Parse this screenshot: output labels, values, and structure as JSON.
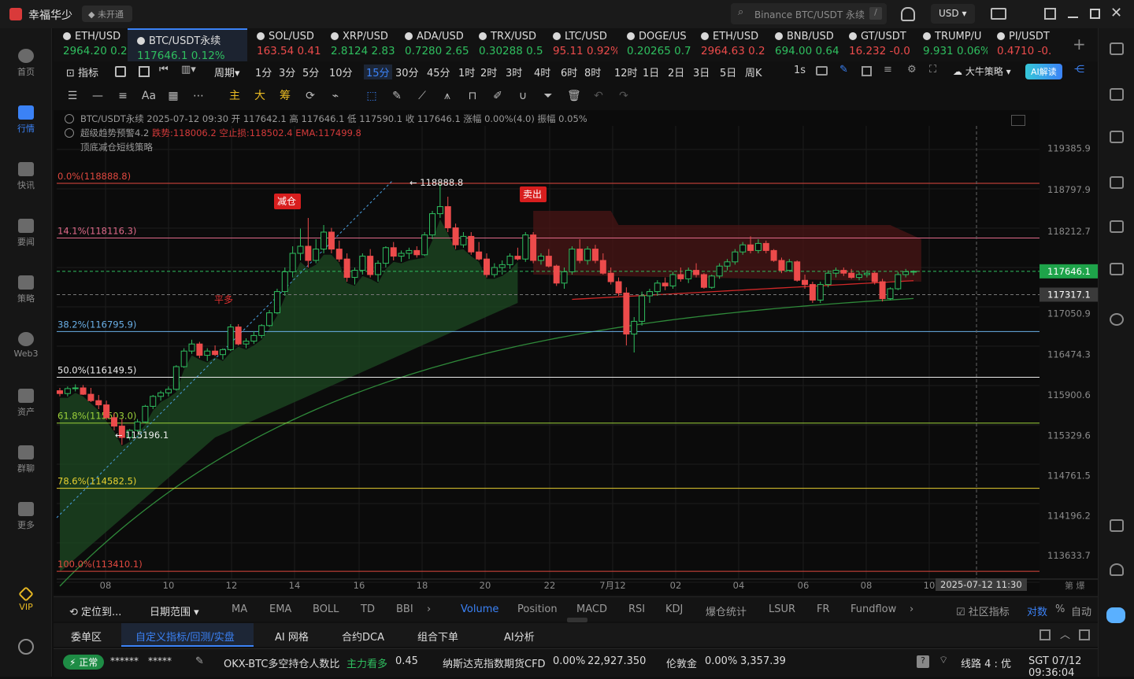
{
  "app": {
    "name": "幸福华少",
    "login_badge": "未开通",
    "search_placeholder": "Binance BTC/USDT 永续",
    "search_shortcut": "/",
    "currency": "USD"
  },
  "tickers": [
    {
      "symbol": "ETH/USD",
      "price": "2964.20",
      "change": "0.2",
      "dir": "up"
    },
    {
      "symbol": "BTC/USDT永续",
      "price": "117646.1",
      "change": "0.12%",
      "dir": "up",
      "active": true
    },
    {
      "symbol": "SOL/USD",
      "price": "163.54",
      "change": "0.41",
      "dir": "dn"
    },
    {
      "symbol": "XRP/USD",
      "price": "2.8124",
      "change": "2.83",
      "dir": "up"
    },
    {
      "symbol": "ADA/USD",
      "price": "0.7280",
      "change": "2.65",
      "dir": "up"
    },
    {
      "symbol": "TRX/USD",
      "price": "0.30288",
      "change": "0.5",
      "dir": "up"
    },
    {
      "symbol": "LTC/USD",
      "price": "95.11",
      "change": "0.92%",
      "dir": "dn"
    },
    {
      "symbol": "DOGE/US",
      "price": "0.20265",
      "change": "0.7",
      "dir": "up"
    },
    {
      "symbol": "ETH/USD",
      "price": "2964.63",
      "change": "0.2",
      "dir": "dn"
    },
    {
      "symbol": "BNB/USD",
      "price": "694.00",
      "change": "0.64",
      "dir": "up"
    },
    {
      "symbol": "GT/USDT",
      "price": "16.232",
      "change": "-0.0",
      "dir": "dn"
    },
    {
      "symbol": "TRUMP/U",
      "price": "9.931",
      "change": "0.06%",
      "dir": "up"
    },
    {
      "symbol": "PI/USDT",
      "price": "0.4710",
      "change": "-0.1",
      "dir": "dn"
    }
  ],
  "toolbar": {
    "indicators": "指标",
    "period": "周期",
    "strategy": "大牛策略",
    "ai_button": "AI解读",
    "seconds": "1s",
    "timeframes": [
      "1分",
      "3分",
      "5分",
      "10分",
      "15分",
      "30分",
      "45分",
      "1时",
      "2时",
      "3时",
      "4时",
      "6时",
      "8时",
      "12时",
      "1日",
      "2日",
      "3日",
      "5日",
      "周K"
    ],
    "active_tf": "15分"
  },
  "drawbar": [
    "主",
    "大",
    "筹"
  ],
  "info": {
    "line1": "BTC/USDT永续 2025-07-12 09:30 开 117642.1 高 117646.1 低 117590.1 收 117646.1 涨幅 0.00%(4.0) 振幅 0.05%",
    "line2a": "超级趋势预警4.2",
    "line2b": "跌势:118006.2 空止损:118502.4 EMA:117499.8",
    "line3": "顶底减仓短线策略"
  },
  "fib": [
    {
      "label": "0.0%(118888.8)",
      "color": "#e0483f",
      "price": 118888.8
    },
    {
      "label": "14.1%(118116.3)",
      "color": "#e06a8a",
      "price": 118116.3
    },
    {
      "label": "38.2%(116795.9)",
      "color": "#6ab0e8",
      "price": 116795.9
    },
    {
      "label": "50.0%(116149.5)",
      "color": "#eaeaea",
      "price": 116149.5
    },
    {
      "label": "61.8%(115503.0)",
      "color": "#9bd13a",
      "price": 115503.0
    },
    {
      "label": "78.6%(114582.5)",
      "color": "#e8d030",
      "price": 114582.5
    },
    {
      "label": "100.0%(113410.1)",
      "color": "#e0483f",
      "price": 113410.1
    }
  ],
  "yticks": [
    "119385.9",
    "118797.9",
    "118212.7",
    "117646.1",
    "117317.1",
    "117050.9",
    "116474.3",
    "115900.6",
    "115329.6",
    "114761.5",
    "114196.2",
    "113633.7"
  ],
  "xticks": [
    "08",
    "10",
    "12",
    "14",
    "16",
    "18",
    "20",
    "22",
    "7月12",
    "02",
    "04",
    "06",
    "08",
    "10"
  ],
  "crosshair_time": "2025-07-12 11:30",
  "signals": {
    "reduce": "减仓",
    "sell": "卖出",
    "flat": "平多",
    "high": "118888.8",
    "low": "115196.1"
  },
  "bottom_tabs": [
    "定位到...",
    "日期范围",
    "MA",
    "EMA",
    "BOLL",
    "TD",
    "BBI",
    "Volume",
    "Position",
    "MACD",
    "RSI",
    "KDJ",
    "爆仓统计",
    "LSUR",
    "FR",
    "Fundflow",
    "社区指标",
    "对数",
    "%",
    "自动"
  ],
  "panel_tabs": [
    "委单区",
    "自定义指标/回测/实盘",
    "AI 网格",
    "合约DCA",
    "组合下单",
    "AI分析"
  ],
  "status": {
    "state": "正常",
    "user": "******",
    "pwd": "*****",
    "ratio_label": "OKX-BTC多空持仓人数比",
    "ratio_tag": "主力看多",
    "ratio_value": "0.45",
    "cfd_label": "纳斯达克指数期货CFD",
    "cfd_pct": "0.00%",
    "cfd_value": "22,927.350",
    "gold_label": "伦敦金",
    "gold_pct": "0.00%",
    "gold_value": "3,357.39",
    "line": "线路 4 : 优",
    "clock": "SGT 07/12 09:36:04"
  },
  "sidebar": [
    "首页",
    "行情",
    "快讯",
    "要闻",
    "策略",
    "Web3",
    "资产",
    "群聊",
    "更多",
    "VIP"
  ],
  "chart_data": {
    "type": "candlestick",
    "symbol": "BTC/USDT永续",
    "interval": "15分",
    "ylim": [
      113300,
      119700
    ],
    "x_labels": [
      "08",
      "10",
      "12",
      "14",
      "16",
      "18",
      "20",
      "22",
      "7月12",
      "02",
      "04",
      "06",
      "08",
      "10"
    ],
    "ohlc": [
      [
        115960,
        116000,
        115880,
        115920
      ],
      [
        115920,
        116020,
        115880,
        115990
      ],
      [
        115990,
        116050,
        115950,
        116000
      ],
      [
        116000,
        116040,
        115900,
        115910
      ],
      [
        115910,
        116000,
        115800,
        115820
      ],
      [
        115820,
        115900,
        115700,
        115760
      ],
      [
        115760,
        115820,
        115550,
        115580
      ],
      [
        115580,
        115650,
        115400,
        115460
      ],
      [
        115460,
        115560,
        115196,
        115300
      ],
      [
        115300,
        115420,
        115260,
        115400
      ],
      [
        115400,
        115560,
        115380,
        115520
      ],
      [
        115520,
        115760,
        115500,
        115740
      ],
      [
        115740,
        115900,
        115700,
        115880
      ],
      [
        115880,
        115960,
        115820,
        115930
      ],
      [
        115930,
        116020,
        115880,
        115980
      ],
      [
        115980,
        116320,
        115960,
        116300
      ],
      [
        116300,
        116560,
        116280,
        116520
      ],
      [
        116520,
        116680,
        116480,
        116620
      ],
      [
        116620,
        116650,
        116420,
        116460
      ],
      [
        116460,
        116560,
        116380,
        116520
      ],
      [
        116520,
        116600,
        116450,
        116470
      ],
      [
        116470,
        116560,
        116400,
        116540
      ],
      [
        116540,
        116900,
        116520,
        116860
      ],
      [
        116860,
        116900,
        116600,
        116620
      ],
      [
        116620,
        116700,
        116560,
        116660
      ],
      [
        116660,
        116800,
        116620,
        116740
      ],
      [
        116740,
        116900,
        116700,
        116880
      ],
      [
        116880,
        117100,
        116860,
        117060
      ],
      [
        117060,
        117400,
        117040,
        117360
      ],
      [
        117360,
        117700,
        117300,
        117640
      ],
      [
        117640,
        118000,
        117560,
        117900
      ],
      [
        117900,
        118250,
        117800,
        118000
      ],
      [
        118000,
        118400,
        117700,
        117800
      ],
      [
        117800,
        118100,
        117760,
        117960
      ],
      [
        117960,
        118300,
        117900,
        118200
      ],
      [
        118200,
        118260,
        117900,
        117960
      ],
      [
        117960,
        118080,
        117780,
        117820
      ],
      [
        117820,
        117900,
        117500,
        117560
      ],
      [
        117560,
        117700,
        117460,
        117660
      ],
      [
        117660,
        117900,
        117600,
        117860
      ],
      [
        117860,
        117960,
        117560,
        117600
      ],
      [
        117600,
        117800,
        117500,
        117760
      ],
      [
        117760,
        118000,
        117700,
        117980
      ],
      [
        117980,
        118060,
        117800,
        117860
      ],
      [
        117860,
        117940,
        117780,
        117900
      ],
      [
        117900,
        117980,
        117820,
        117940
      ],
      [
        117940,
        118000,
        117840,
        117880
      ],
      [
        117880,
        118200,
        117860,
        118160
      ],
      [
        118160,
        118500,
        118100,
        118460
      ],
      [
        118460,
        118888,
        118400,
        118560
      ],
      [
        118560,
        118700,
        118200,
        118260
      ],
      [
        118260,
        118320,
        117960,
        118020
      ],
      [
        118020,
        118200,
        117980,
        118140
      ],
      [
        118140,
        118200,
        117880,
        117920
      ],
      [
        117920,
        118060,
        117800,
        117820
      ],
      [
        117820,
        117900,
        117560,
        117600
      ],
      [
        117600,
        117760,
        117560,
        117700
      ],
      [
        117700,
        117800,
        117600,
        117740
      ],
      [
        117740,
        117900,
        117680,
        117860
      ],
      [
        117860,
        117980,
        117800,
        117820
      ],
      [
        117820,
        118200,
        117780,
        118160
      ],
      [
        118160,
        118200,
        117760,
        117800
      ],
      [
        117800,
        117900,
        117740,
        117860
      ],
      [
        117860,
        117960,
        117700,
        117720
      ],
      [
        117720,
        117740,
        117440,
        117480
      ],
      [
        117480,
        117700,
        117400,
        117640
      ],
      [
        117640,
        118000,
        117600,
        117960
      ],
      [
        117960,
        118100,
        117760,
        117800
      ],
      [
        117800,
        118000,
        117740,
        117960
      ],
      [
        117960,
        118020,
        117760,
        117800
      ],
      [
        117800,
        117900,
        117600,
        117620
      ],
      [
        117620,
        117700,
        117460,
        117500
      ],
      [
        117500,
        117560,
        117300,
        117340
      ],
      [
        117340,
        117420,
        116600,
        116760
      ],
      [
        116760,
        117000,
        116500,
        116940
      ],
      [
        116940,
        117360,
        116880,
        117300
      ],
      [
        117300,
        117400,
        117200,
        117360
      ],
      [
        117360,
        117520,
        117300,
        117480
      ],
      [
        117480,
        117560,
        117380,
        117440
      ],
      [
        117440,
        117640,
        117400,
        117600
      ],
      [
        117600,
        117700,
        117500,
        117540
      ],
      [
        117540,
        117700,
        117480,
        117660
      ],
      [
        117660,
        117760,
        117560,
        117600
      ],
      [
        117600,
        117620,
        117400,
        117420
      ],
      [
        117420,
        117600,
        117400,
        117580
      ],
      [
        117580,
        117760,
        117540,
        117720
      ],
      [
        117720,
        117820,
        117660,
        117780
      ],
      [
        117780,
        117960,
        117740,
        117920
      ],
      [
        117920,
        118060,
        117880,
        118020
      ],
      [
        118020,
        118140,
        117900,
        117940
      ],
      [
        117940,
        118100,
        117900,
        118040
      ],
      [
        118040,
        118080,
        117900,
        117940
      ],
      [
        117940,
        117960,
        117780,
        117800
      ],
      [
        117800,
        117840,
        117620,
        117660
      ],
      [
        117660,
        117820,
        117640,
        117780
      ],
      [
        117780,
        117800,
        117500,
        117520
      ],
      [
        117520,
        117600,
        117400,
        117460
      ],
      [
        117460,
        117500,
        117200,
        117240
      ],
      [
        117240,
        117500,
        117200,
        117460
      ],
      [
        117460,
        117660,
        117420,
        117620
      ],
      [
        117620,
        117700,
        117560,
        117660
      ],
      [
        117660,
        117700,
        117580,
        117620
      ],
      [
        117620,
        117680,
        117540,
        117560
      ],
      [
        117560,
        117640,
        117520,
        117600
      ],
      [
        117600,
        117660,
        117560,
        117620
      ],
      [
        117620,
        117640,
        117460,
        117500
      ],
      [
        117500,
        117540,
        117220,
        117260
      ],
      [
        117260,
        117420,
        117240,
        117400
      ],
      [
        117400,
        117640,
        117380,
        117600
      ],
      [
        117600,
        117680,
        117560,
        117640
      ],
      [
        117640,
        117660,
        117590,
        117646
      ]
    ]
  }
}
